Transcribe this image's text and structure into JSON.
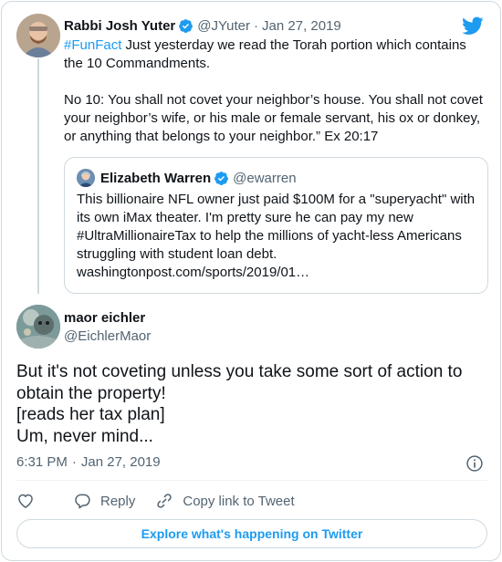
{
  "parent_tweet": {
    "author_name": "Rabbi Josh Yuter",
    "handle": "@JYuter",
    "separator": "·",
    "date": "Jan 27, 2019",
    "hashtag": "#FunFact",
    "text_line1": " Just yesterday we read the Torah portion which contains the 10 Commandments.",
    "text_line2": "No 10: You shall not covet your neighbor’s house. You shall not covet your neighbor’s wife, or his male or female servant, his ox or donkey, or anything that belongs to your neighbor.” Ex 20:17"
  },
  "quoted_tweet": {
    "author_name": "Elizabeth Warren",
    "handle": "@ewarren",
    "text": "This billionaire NFL owner just paid $100M for a \"superyacht\" with its own iMax theater. I'm pretty sure he can pay my new #UltraMillionaireTax to help the millions of yacht-less Americans struggling with student loan debt.",
    "link": "washingtonpost.com/sports/2019/01…"
  },
  "main_tweet": {
    "author_name": "maor eichler",
    "handle": "@EichlerMaor",
    "lines": [
      "But it's not coveting unless you take some sort of action to obtain the property!",
      "[reads her tax plan]",
      "Um, never mind..."
    ],
    "time": "6:31 PM",
    "separator": "·",
    "date": "Jan 27, 2019"
  },
  "actions": {
    "reply_label": "Reply",
    "copy_link_label": "Copy link to Tweet"
  },
  "explore_label": "Explore what's happening on Twitter",
  "colors": {
    "accent": "#1d9bf0",
    "text": "#0f1419",
    "secondary": "#536471",
    "border": "#cfd9de"
  },
  "icons": [
    "twitter-bird-icon",
    "verified-badge-icon",
    "info-icon",
    "heart-icon",
    "reply-icon",
    "link-icon"
  ]
}
